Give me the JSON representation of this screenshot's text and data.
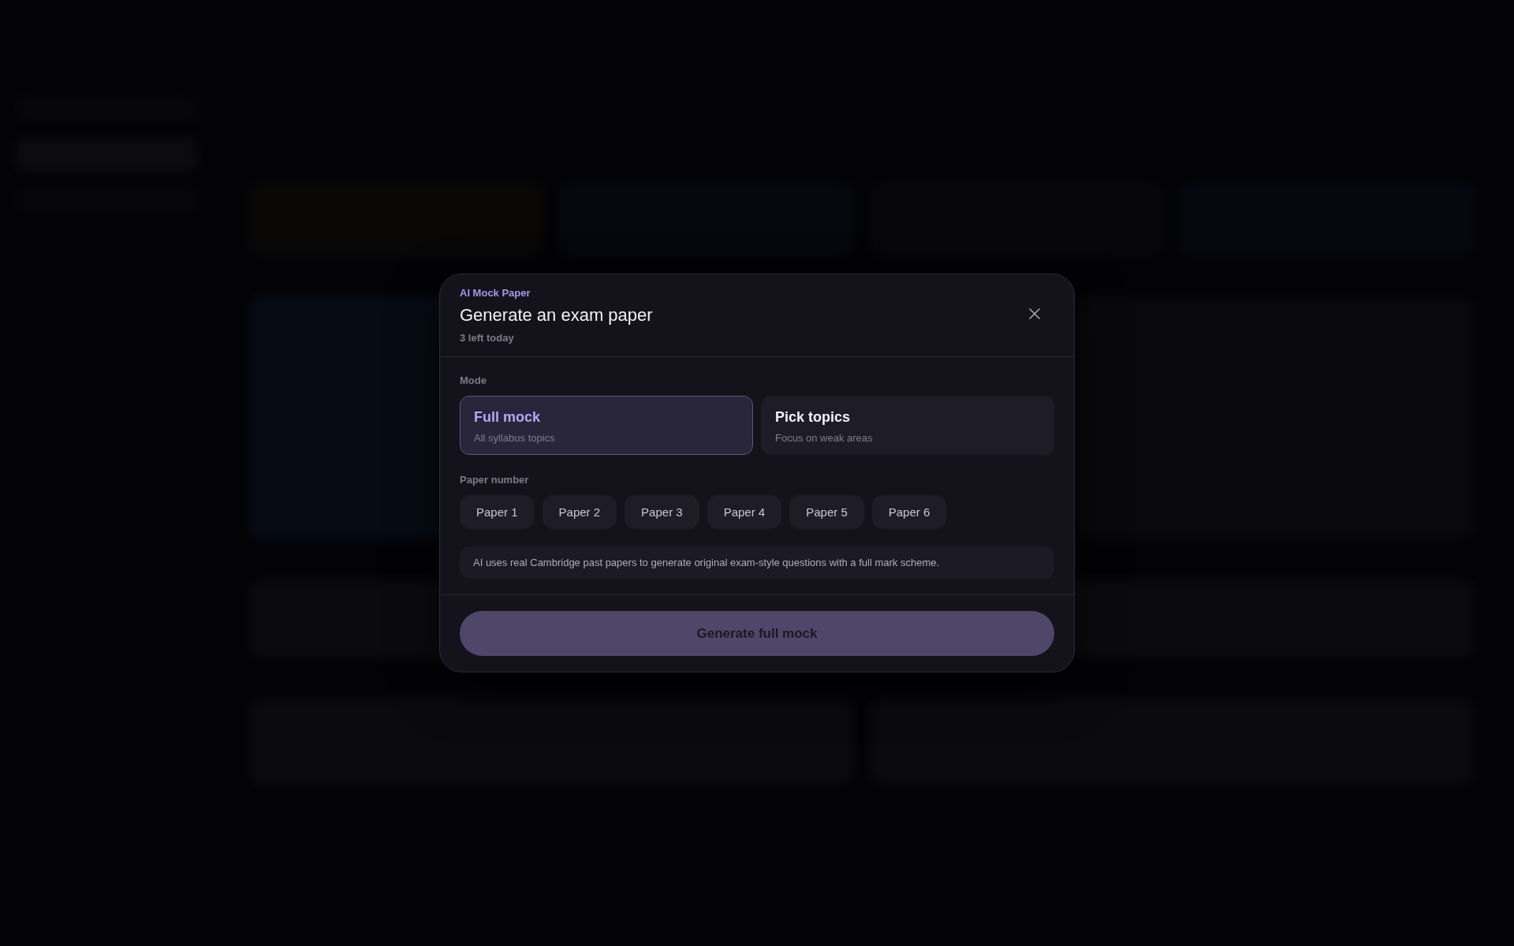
{
  "dialog": {
    "eyebrow": "AI Mock Paper",
    "title": "Generate an exam paper",
    "subtitle": "3 left today",
    "mode": {
      "label": "Mode",
      "options": [
        {
          "title": "Full mock",
          "description": "All syllabus topics",
          "selected": true
        },
        {
          "title": "Pick topics",
          "description": "Focus on weak areas",
          "selected": false
        }
      ]
    },
    "paper_number": {
      "label": "Paper number",
      "options": [
        {
          "label": "Paper 1",
          "selected": false
        },
        {
          "label": "Paper 2",
          "selected": false
        },
        {
          "label": "Paper 3",
          "selected": false
        },
        {
          "label": "Paper 4",
          "selected": false
        },
        {
          "label": "Paper 5",
          "selected": false
        },
        {
          "label": "Paper 6",
          "selected": false
        }
      ]
    },
    "note": "AI uses real Cambridge past papers to generate original exam-style questions with a full mark scheme.",
    "primary_button": "Generate full mock"
  }
}
